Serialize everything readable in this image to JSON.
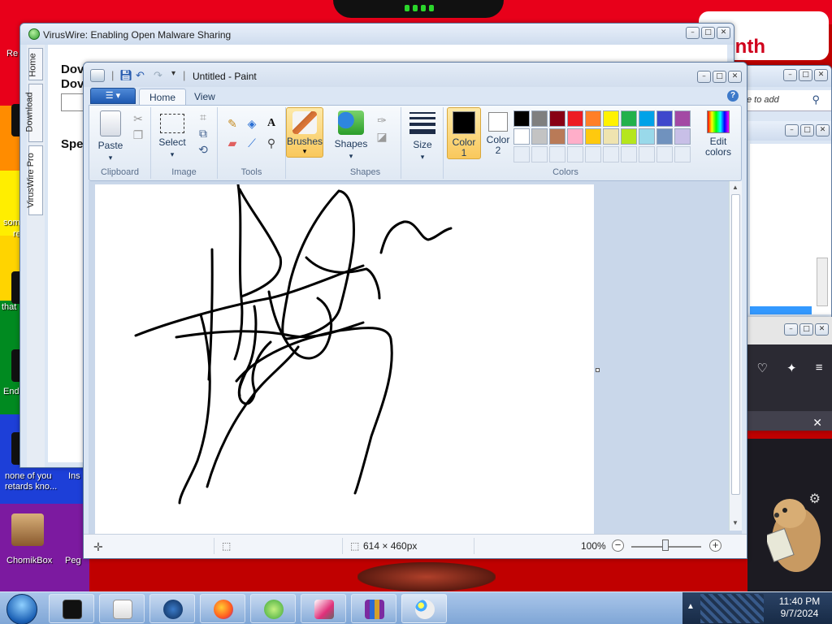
{
  "desktop": {
    "icons": [
      {
        "label": "none of you retards kno..."
      },
      {
        "label": "ChomikBox"
      },
      {
        "label": "Peg"
      },
      {
        "label": "Ins"
      },
      {
        "label": "Re"
      },
      {
        "label": "som"
      },
      {
        "label": "re"
      },
      {
        "label": "that"
      },
      {
        "label": "End"
      }
    ],
    "banner_text": "onth"
  },
  "viruswire": {
    "title": "VirusWire: Enabling Open Malware Sharing",
    "side_tabs": [
      "Home",
      "Download",
      "VirusWire Pro"
    ],
    "content_lines": [
      "Dov",
      "Dov",
      "Spe"
    ]
  },
  "right_window": {
    "search_placeholder": "e to add"
  },
  "paint": {
    "title": "Untitled - Paint",
    "tabs": [
      "Home",
      "View"
    ],
    "groups": {
      "clipboard": {
        "label": "Clipboard",
        "paste": "Paste"
      },
      "image": {
        "label": "Image",
        "select": "Select"
      },
      "tools": {
        "label": "Tools"
      },
      "brushes": {
        "label": "Brushes"
      },
      "shapes": {
        "label": "Shapes",
        "button": "Shapes"
      },
      "size": {
        "label": "Size"
      },
      "colors": {
        "label": "Colors",
        "color1": "Color 1",
        "color2": "Color 2",
        "edit": "Edit colors"
      }
    },
    "color1_value": "#000000",
    "color2_value": "#ffffff",
    "palette": [
      "#000000",
      "#7f7f7f",
      "#880015",
      "#ed1c24",
      "#ff7f27",
      "#fff200",
      "#22b14c",
      "#00a2e8",
      "#3f48cc",
      "#a349a4",
      "#ffffff",
      "#c3c3c3",
      "#b97a57",
      "#ffaec9",
      "#ffc90e",
      "#efe4b0",
      "#b5e61d",
      "#99d9ea",
      "#7092be",
      "#c8bfe7"
    ],
    "status": {
      "canvas_size": "614 × 460px",
      "zoom": "100%"
    }
  },
  "clock": {
    "time": "11:40 PM",
    "date": "9/7/2024"
  }
}
